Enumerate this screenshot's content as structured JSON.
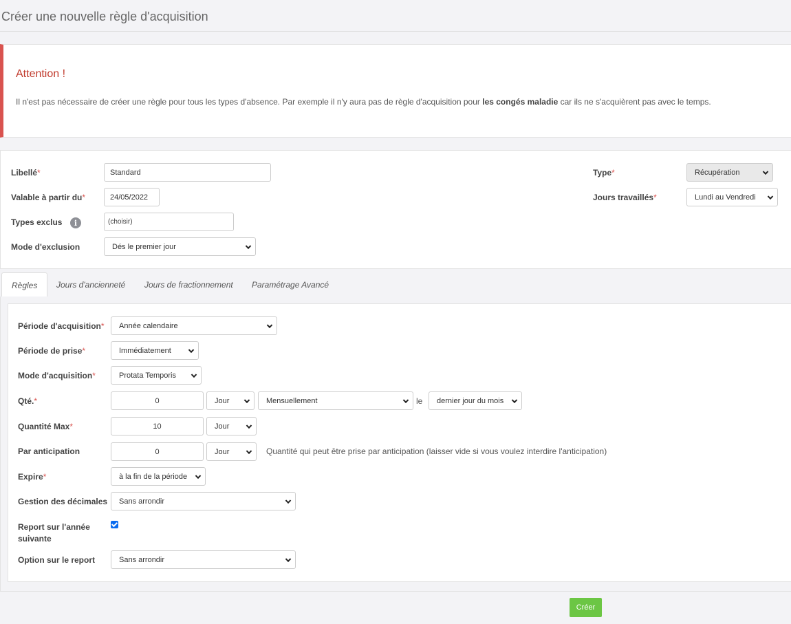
{
  "page": {
    "title": "Créer une nouvelle règle d'acquisition"
  },
  "alert": {
    "title": "Attention !",
    "text_before": "Il n'est pas nécessaire de créer une règle pour tous les types d'absence. Par exemple il n'y aura pas de règle d'acquisition pour ",
    "text_bold": "les congés maladie",
    "text_after": " car ils ne s'acquièrent pas avec le temps."
  },
  "form": {
    "required_mark": "*",
    "libelle": {
      "label": "Libellé",
      "value": "Standard"
    },
    "valable": {
      "label": "Valable à partir du",
      "value": "24/05/2022"
    },
    "types_exclus": {
      "label": "Types exclus",
      "value": "(choisir)"
    },
    "mode_exclusion": {
      "label": "Mode d'exclusion",
      "value": "Dés le premier jour"
    },
    "type": {
      "label": "Type",
      "value": "Récupération"
    },
    "jours_travailles": {
      "label": "Jours travaillés",
      "value": "Lundi au Vendredi"
    }
  },
  "tabs": [
    {
      "label": "Règles",
      "active": true
    },
    {
      "label": "Jours d'ancienneté",
      "active": false
    },
    {
      "label": "Jours de fractionnement",
      "active": false
    },
    {
      "label": "Paramétrage Avancé",
      "active": false
    }
  ],
  "rules": {
    "periode_acquisition": {
      "label": "Période d'acquisition",
      "value": "Année calendaire"
    },
    "periode_prise": {
      "label": "Période de prise",
      "value": "Immédiatement"
    },
    "mode_acquisition": {
      "label": "Mode d'acquisition",
      "value": "Protata Temporis"
    },
    "qte": {
      "label": "Qté.",
      "value": "0",
      "unit": "Jour",
      "frequency": "Mensuellement",
      "le": "le",
      "day": "dernier jour du mois"
    },
    "quantite_max": {
      "label": "Quantité Max",
      "value": "10",
      "unit": "Jour"
    },
    "par_anticipation": {
      "label": "Par anticipation",
      "value": "0",
      "unit": "Jour",
      "hint": "Quantité qui peut être prise par anticipation (laisser vide si vous voulez interdire l'anticipation)"
    },
    "expire": {
      "label": "Expire",
      "value": "à la fin de la période"
    },
    "gestion_decimales": {
      "label": "Gestion des décimales",
      "value": "Sans arrondir"
    },
    "report": {
      "label_line1": "Report sur l'année",
      "label_line2": "suivante",
      "checked": true
    },
    "option_report": {
      "label": "Option sur le report",
      "value": "Sans arrondir"
    }
  },
  "actions": {
    "create_label": "Créer"
  }
}
